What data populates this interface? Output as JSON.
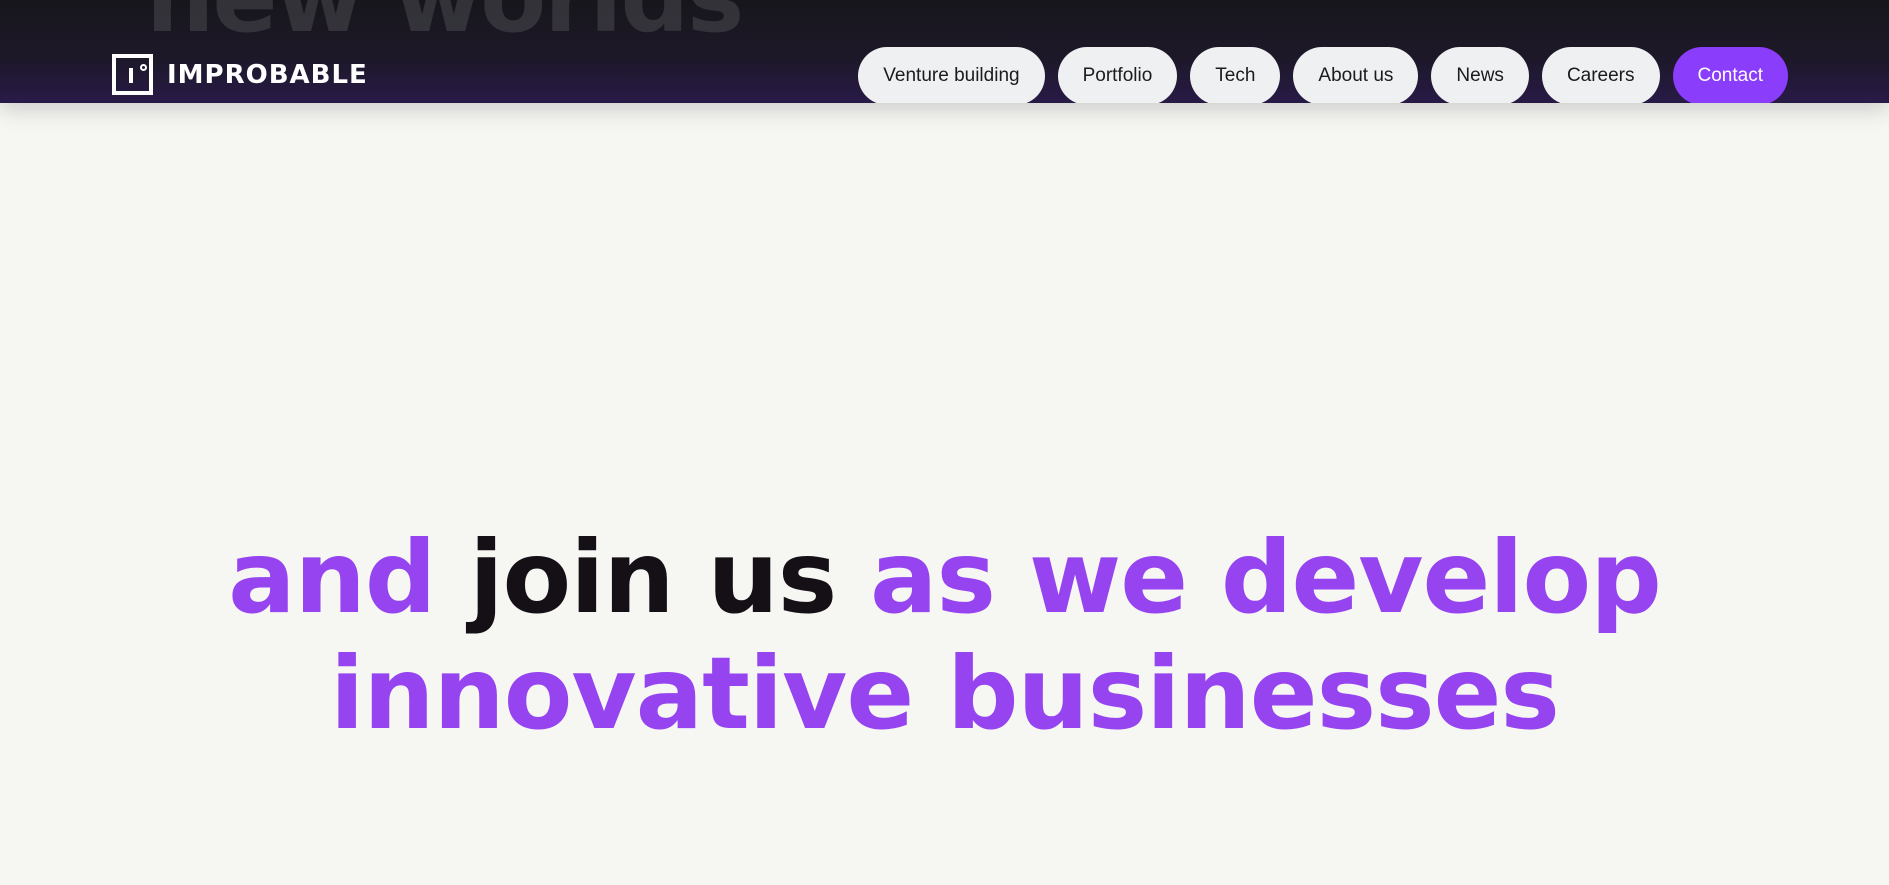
{
  "header": {
    "ghost_text": "new worlds",
    "logo_text": "IMPROBABLE",
    "nav": [
      {
        "label": "Venture building"
      },
      {
        "label": "Portfolio"
      },
      {
        "label": "Tech"
      },
      {
        "label": "About us"
      },
      {
        "label": "News"
      },
      {
        "label": "Careers"
      },
      {
        "label": "Contact"
      }
    ]
  },
  "hero": {
    "part1": "and ",
    "part2": "join us",
    "part3": " as we develop",
    "line2": "innovative businesses"
  },
  "colors": {
    "accent": "#8a3dfa",
    "headline_purple": "#9544f0",
    "header_bg": "#1d1828",
    "page_bg": "#f6f6f3",
    "nav_pill_bg": "#eff0f2"
  }
}
